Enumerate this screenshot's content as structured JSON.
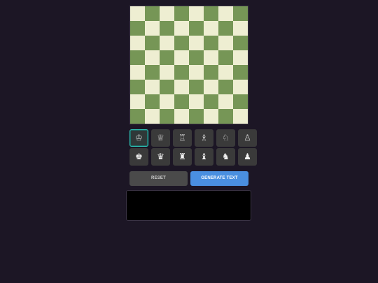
{
  "board": {
    "light_color": "#eeeed2",
    "dark_color": "#769656",
    "pieces_on_board": []
  },
  "palette": {
    "white": [
      {
        "piece": "king",
        "glyph": "♔",
        "selected": true
      },
      {
        "piece": "queen",
        "glyph": "♕",
        "selected": false
      },
      {
        "piece": "rook",
        "glyph": "♖",
        "selected": false
      },
      {
        "piece": "bishop",
        "glyph": "♗",
        "selected": false
      },
      {
        "piece": "knight",
        "glyph": "♘",
        "selected": false
      },
      {
        "piece": "pawn",
        "glyph": "♙",
        "selected": false
      }
    ],
    "black": [
      {
        "piece": "king",
        "glyph": "♚",
        "selected": false
      },
      {
        "piece": "queen",
        "glyph": "♛",
        "selected": false
      },
      {
        "piece": "rook",
        "glyph": "♜",
        "selected": false
      },
      {
        "piece": "bishop",
        "glyph": "♝",
        "selected": false
      },
      {
        "piece": "knight",
        "glyph": "♞",
        "selected": false
      },
      {
        "piece": "pawn",
        "glyph": "♟",
        "selected": false
      }
    ],
    "selected_accent": "#2ec4b6"
  },
  "buttons": {
    "reset_label": "RESET",
    "generate_label": "GENERATE TEXT",
    "generate_color": "#4a8fe0"
  },
  "output": {
    "value": ""
  }
}
